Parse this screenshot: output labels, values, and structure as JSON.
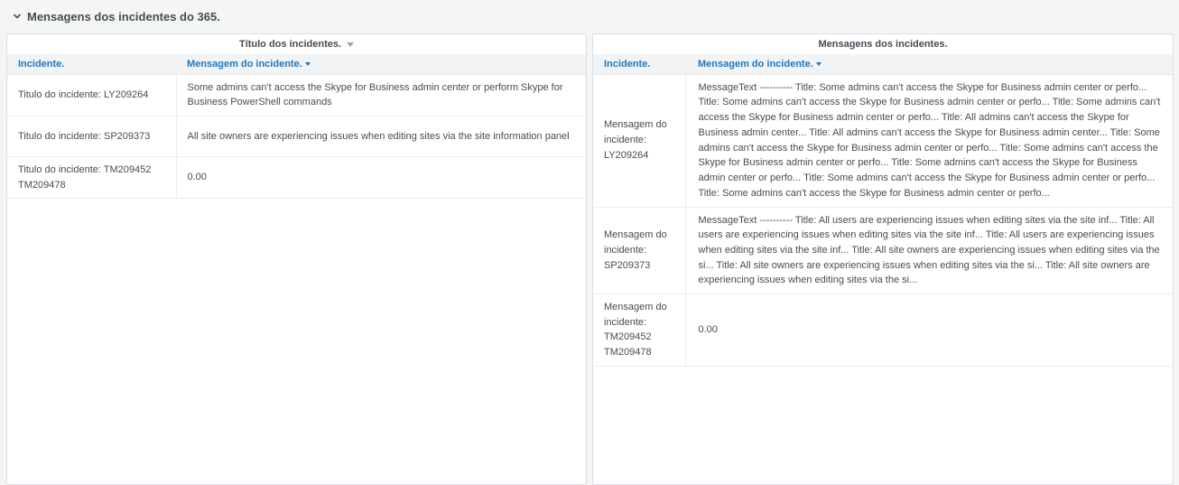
{
  "row": {
    "title": "Mensagens dos incidentes do 365."
  },
  "left_panel": {
    "title": "Título dos incidentes.",
    "columns": [
      "Incidente.",
      "Mensagem do incidente."
    ],
    "rows": [
      {
        "incident": "Titulo do incidente: LY209264",
        "message": "Some admins can't access the Skype for Business admin center or perform Skype for Business PowerShell commands"
      },
      {
        "incident": "Titulo do incidente: SP209373",
        "message": "All site owners are experiencing issues when editing sites via the site information panel"
      },
      {
        "incident": "Titulo do incidente: TM209452 TM209478",
        "message": "0.00"
      }
    ]
  },
  "right_panel": {
    "title": "Mensagens dos incidentes.",
    "columns": [
      "Incidente.",
      "Mensagem do incidente."
    ],
    "rows": [
      {
        "incident": "Mensagem do incidente: LY209264",
        "message": "MessageText ---------- Title: Some admins can't access the Skype for Business admin center or perfo... Title: Some admins can't access the Skype for Business admin center or perfo... Title: Some admins can't access the Skype for Business admin center or perfo... Title: All admins can't access the Skype for Business admin center... Title: All admins can't access the Skype for Business admin center... Title: Some admins can't access the Skype for Business admin center or perfo... Title: Some admins can't access the Skype for Business admin center or perfo... Title: Some admins can't access the Skype for Business admin center or perfo... Title: Some admins can't access the Skype for Business admin center or perfo... Title: Some admins can't access the Skype for Business admin center or perfo..."
      },
      {
        "incident": "Mensagem do incidente: SP209373",
        "message": "MessageText ---------- Title: All users are experiencing issues when editing sites via the site inf... Title: All users are experiencing issues when editing sites via the site inf... Title: All users are experiencing issues when editing sites via the site inf... Title: All site owners are experiencing issues when editing sites via the si... Title: All site owners are experiencing issues when editing sites via the si... Title: All site owners are experiencing issues when editing sites via the si..."
      },
      {
        "incident": "Mensagem do incidente: TM209452 TM209478",
        "message": "0.00"
      }
    ]
  },
  "colors": {
    "accent": "#1f78c1",
    "text": "#464c54",
    "background": "#f4f5f5",
    "panel": "#ffffff"
  },
  "icons": {
    "collapse": "chevron-down-icon",
    "panel_menu": "caret-down-icon",
    "sort": "sort-desc-icon"
  }
}
